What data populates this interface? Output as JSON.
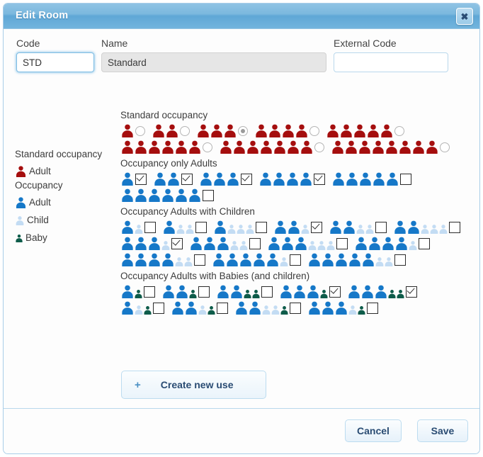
{
  "window": {
    "title": "Edit Room",
    "close_icon": "close-icon",
    "close_glyph": "✖"
  },
  "form": {
    "code": {
      "label": "Code",
      "value": "STD",
      "placeholder": ""
    },
    "name": {
      "label": "Name",
      "value": "Standard",
      "placeholder": ""
    },
    "external_code": {
      "label": "External Code",
      "value": "",
      "placeholder": ""
    }
  },
  "legend": {
    "standard_heading": "Standard occupancy",
    "standard_items": [
      {
        "label": "Adult",
        "icon": "adult-icon",
        "color": "#A50E0E"
      }
    ],
    "occupancy_heading": "Occupancy",
    "occupancy_items": [
      {
        "label": "Adult",
        "icon": "adult-icon",
        "color": "#1678C8"
      },
      {
        "label": "Child",
        "icon": "child-icon",
        "color": "#C3DCF3"
      },
      {
        "label": "Baby",
        "icon": "baby-icon",
        "color": "#0E5C4A"
      }
    ]
  },
  "colors": {
    "adult_red": "#A50E0E",
    "adult_blue": "#1678C8",
    "child_blue": "#C3DCF3",
    "baby_green": "#0E5C4A",
    "title_blue": "#6FB1DA",
    "border_blue": "#A8CDE8"
  },
  "sections": [
    {
      "id": "standard-occupancy",
      "title": "Standard occupancy",
      "control": "radio",
      "options": [
        {
          "adults": 1,
          "children": 0,
          "babies": 0,
          "selected": false
        },
        {
          "adults": 2,
          "children": 0,
          "babies": 0,
          "selected": false
        },
        {
          "adults": 3,
          "children": 0,
          "babies": 0,
          "selected": true
        },
        {
          "adults": 4,
          "children": 0,
          "babies": 0,
          "selected": false
        },
        {
          "adults": 5,
          "children": 0,
          "babies": 0,
          "selected": false
        },
        {
          "adults": 6,
          "children": 0,
          "babies": 0,
          "selected": false
        },
        {
          "adults": 7,
          "children": 0,
          "babies": 0,
          "selected": false
        },
        {
          "adults": 8,
          "children": 0,
          "babies": 0,
          "selected": false
        }
      ]
    },
    {
      "id": "occupancy-only-adults",
      "title": "Occupancy only Adults",
      "control": "checkbox",
      "options": [
        {
          "adults": 1,
          "children": 0,
          "babies": 0,
          "selected": true
        },
        {
          "adults": 2,
          "children": 0,
          "babies": 0,
          "selected": true
        },
        {
          "adults": 3,
          "children": 0,
          "babies": 0,
          "selected": true
        },
        {
          "adults": 4,
          "children": 0,
          "babies": 0,
          "selected": true
        },
        {
          "adults": 5,
          "children": 0,
          "babies": 0,
          "selected": false
        },
        {
          "adults": 6,
          "children": 0,
          "babies": 0,
          "selected": false
        }
      ]
    },
    {
      "id": "occupancy-adults-with-children",
      "title": "Occupancy Adults with Children",
      "control": "checkbox",
      "options": [
        {
          "adults": 1,
          "children": 1,
          "babies": 0,
          "selected": false
        },
        {
          "adults": 1,
          "children": 2,
          "babies": 0,
          "selected": false
        },
        {
          "adults": 1,
          "children": 3,
          "babies": 0,
          "selected": false
        },
        {
          "adults": 2,
          "children": 1,
          "babies": 0,
          "selected": true
        },
        {
          "adults": 2,
          "children": 2,
          "babies": 0,
          "selected": false
        },
        {
          "adults": 2,
          "children": 3,
          "babies": 0,
          "selected": false
        },
        {
          "adults": 3,
          "children": 1,
          "babies": 0,
          "selected": true
        },
        {
          "adults": 3,
          "children": 2,
          "babies": 0,
          "selected": false
        },
        {
          "adults": 3,
          "children": 3,
          "babies": 0,
          "selected": false
        },
        {
          "adults": 4,
          "children": 1,
          "babies": 0,
          "selected": false
        },
        {
          "adults": 4,
          "children": 2,
          "babies": 0,
          "selected": false
        },
        {
          "adults": 5,
          "children": 1,
          "babies": 0,
          "selected": false
        },
        {
          "adults": 5,
          "children": 2,
          "babies": 0,
          "selected": false
        }
      ]
    },
    {
      "id": "occupancy-adults-with-babies",
      "title": "Occupancy Adults with Babies (and children)",
      "control": "checkbox",
      "options": [
        {
          "adults": 1,
          "children": 0,
          "babies": 1,
          "selected": false
        },
        {
          "adults": 2,
          "children": 0,
          "babies": 1,
          "selected": false
        },
        {
          "adults": 2,
          "children": 0,
          "babies": 2,
          "selected": false
        },
        {
          "adults": 3,
          "children": 0,
          "babies": 1,
          "selected": true
        },
        {
          "adults": 3,
          "children": 0,
          "babies": 2,
          "selected": true
        },
        {
          "adults": 1,
          "children": 1,
          "babies": 1,
          "selected": false
        },
        {
          "adults": 2,
          "children": 1,
          "babies": 1,
          "selected": false
        },
        {
          "adults": 2,
          "children": 2,
          "babies": 1,
          "selected": false
        },
        {
          "adults": 3,
          "children": 1,
          "babies": 1,
          "selected": false
        }
      ]
    }
  ],
  "create_button": {
    "label": "Create new use",
    "plus": "+",
    "icon": "plus-icon"
  },
  "footer": {
    "cancel_label": "Cancel",
    "save_label": "Save"
  }
}
